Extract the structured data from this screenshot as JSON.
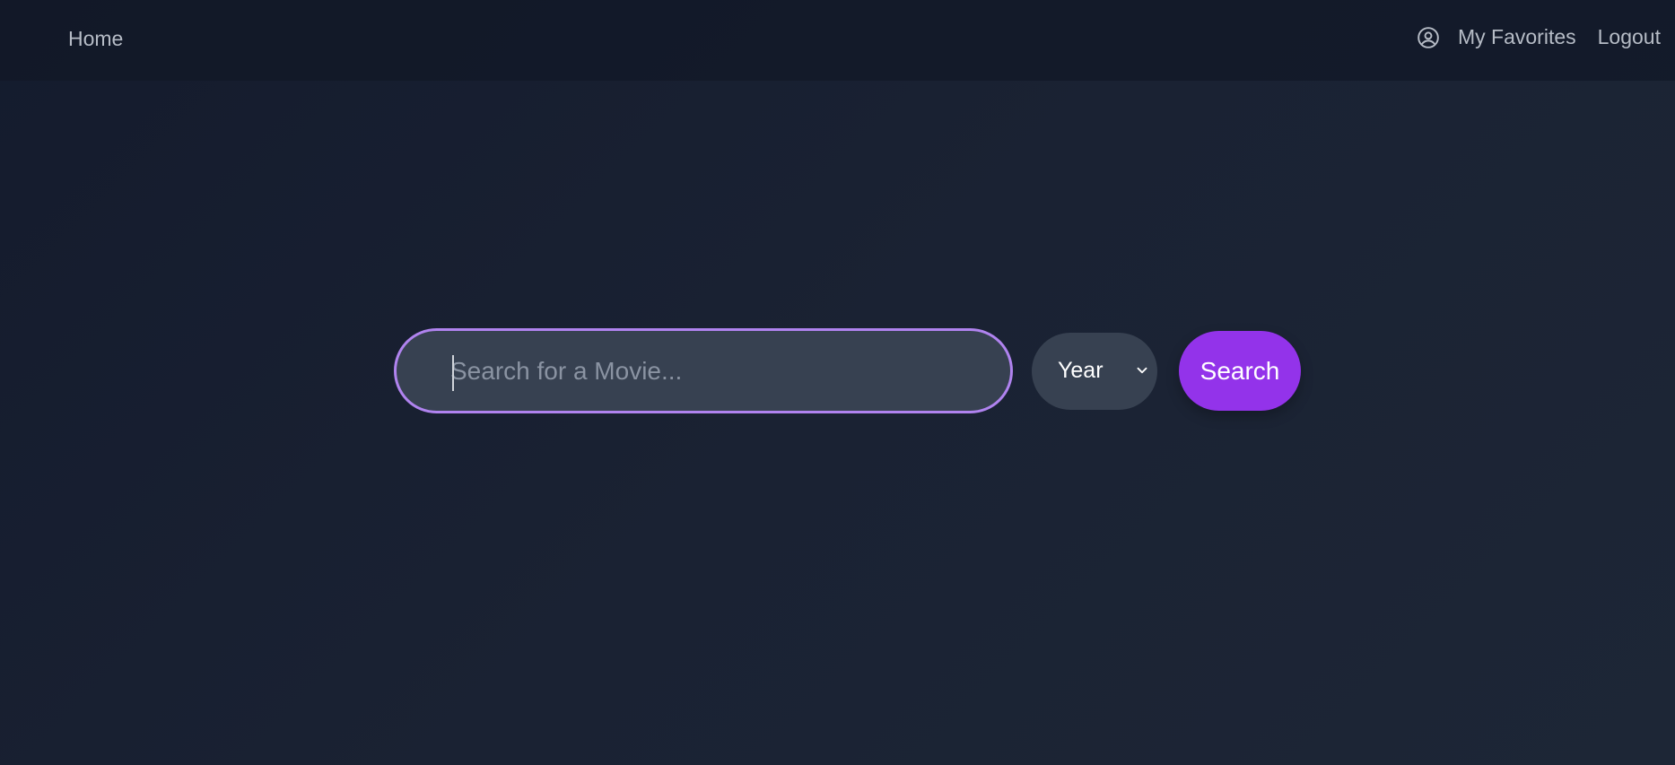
{
  "nav": {
    "home_label": "Home",
    "user_icon": "user-circle-icon",
    "favorites_label": "My Favorites",
    "logout_label": "Logout"
  },
  "search": {
    "placeholder": "Search for a Movie...",
    "value": "",
    "year_selected": "Year",
    "button_label": "Search"
  },
  "colors": {
    "accent": "#9333ea",
    "focus_border": "#b083ef",
    "field_background": "#374151",
    "page_background": "#1a2233"
  }
}
